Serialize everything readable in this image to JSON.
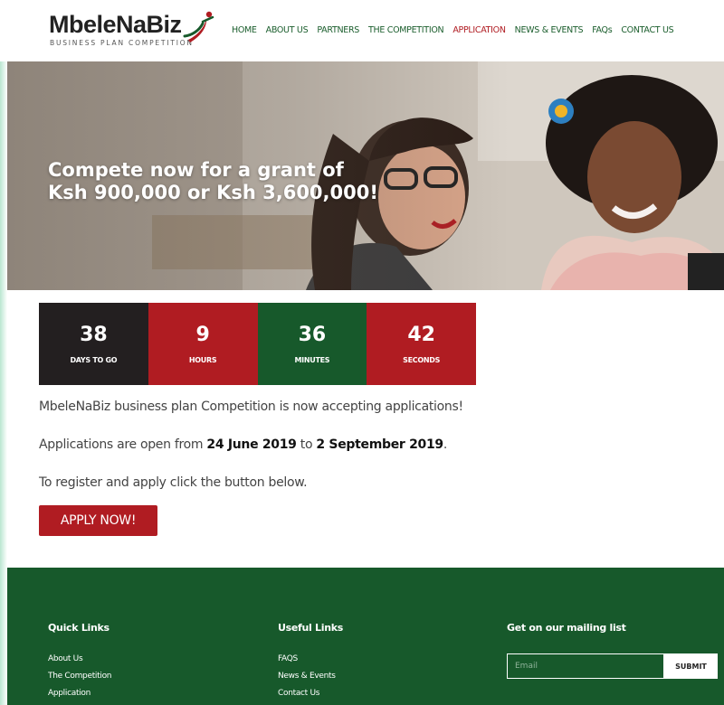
{
  "brand": {
    "name": "MbeleNaBiz",
    "tagline": "BUSINESS PLAN COMPETITION"
  },
  "nav": {
    "items": [
      {
        "label": "HOME"
      },
      {
        "label": "ABOUT US"
      },
      {
        "label": "PARTNERS"
      },
      {
        "label": "THE COMPETITION"
      },
      {
        "label": "APPLICATION",
        "active": true
      },
      {
        "label": "NEWS & EVENTS"
      },
      {
        "label": "FAQs"
      },
      {
        "label": "CONTACT US"
      }
    ]
  },
  "hero": {
    "line1": "Compete now for a grant of",
    "line2": "Ksh 900,000 or Ksh 3,600,000!"
  },
  "countdown": {
    "days": {
      "value": "38",
      "label": "DAYS TO GO",
      "color": "#231f20"
    },
    "hours": {
      "value": "9",
      "label": "HOURS",
      "color": "#b01c22"
    },
    "minutes": {
      "value": "36",
      "label": "MINUTES",
      "color": "#17592b"
    },
    "seconds": {
      "value": "42",
      "label": "SECONDS",
      "color": "#b01c22"
    }
  },
  "content": {
    "intro": "MbeleNaBiz business plan Competition is now accepting applications!",
    "dates_prefix": "Applications are open from ",
    "date_start": "24 June 2019",
    "dates_mid": " to ",
    "date_end": "2 September 2019",
    "dates_suffix": ".",
    "register_text": "To register and apply click the button below.",
    "apply_label": "APPLY NOW!"
  },
  "footer": {
    "quick_links_title": "Quick Links",
    "quick_links": [
      "About Us",
      "The Competition",
      "Application"
    ],
    "useful_links_title": "Useful Links",
    "useful_links": [
      "FAQS",
      "News & Events",
      "Contact Us"
    ],
    "mailing_title": "Get on our mailing list",
    "email_placeholder": "Email",
    "submit_label": "SUBMIT"
  },
  "colors": {
    "brand_red": "#b01c22",
    "brand_green": "#17592b",
    "dark": "#231f20"
  }
}
